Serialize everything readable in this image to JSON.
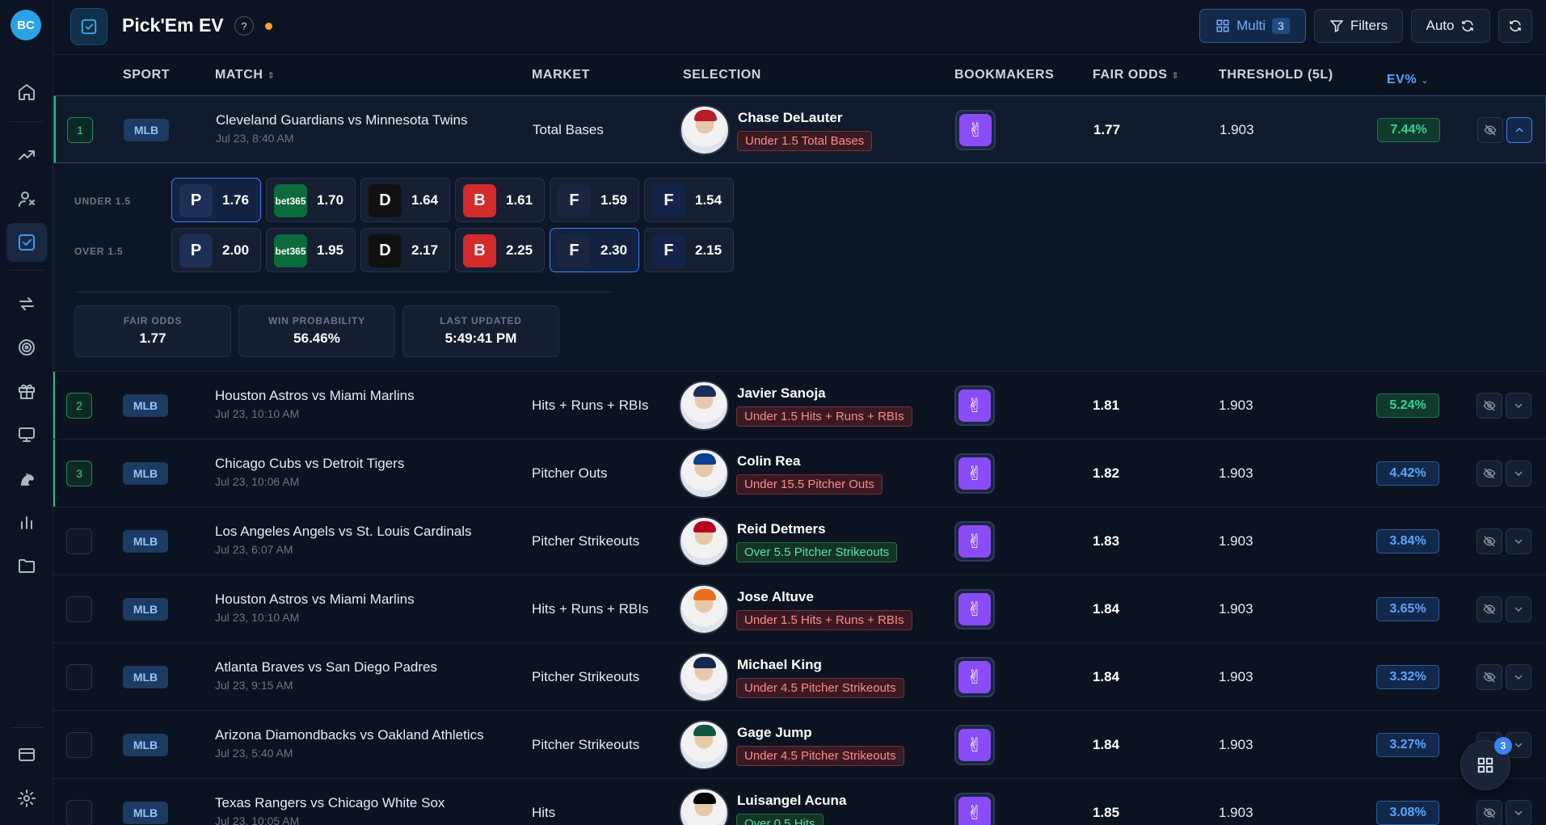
{
  "app": {
    "logo_text": "BC"
  },
  "sidebar": {
    "items": [
      {
        "icon": "home-icon"
      },
      {
        "icon": "trending-icon"
      },
      {
        "icon": "user-icon"
      },
      {
        "icon": "pickem-icon",
        "active": true
      },
      {
        "icon": "arbitrage-icon"
      },
      {
        "icon": "target-icon"
      },
      {
        "icon": "gift-icon"
      },
      {
        "icon": "monitor-icon"
      },
      {
        "icon": "horse-icon"
      },
      {
        "icon": "bar-chart-icon"
      },
      {
        "icon": "folder-icon"
      },
      {
        "icon": "card-icon"
      },
      {
        "icon": "settings-icon"
      }
    ]
  },
  "header": {
    "title": "Pick'Em EV",
    "help": "?",
    "multi_label": "Multi",
    "multi_count": "3",
    "filters_label": "Filters",
    "auto_label": "Auto"
  },
  "columns": {
    "sport": "SPORT",
    "match": "MATCH",
    "market": "MARKET",
    "selection": "SELECTION",
    "bookmakers": "BOOKMAKERS",
    "fair_odds": "FAIR ODDS",
    "threshold": "THRESHOLD (5L)",
    "ev": "EV%"
  },
  "rows": [
    {
      "rank": "1",
      "sport": "MLB",
      "match": "Cleveland Guardians vs Minnesota Twins",
      "time": "Jul 23, 8:40 AM",
      "market": "Total Bases",
      "player": "Chase DeLauter",
      "pick": "Under 1.5 Total Bases",
      "side": "under",
      "fair": "1.77",
      "threshold": "1.903",
      "ev": "7.44%",
      "ev_color": "green"
    },
    {
      "rank": "2",
      "sport": "MLB",
      "match": "Houston Astros vs Miami Marlins",
      "time": "Jul 23, 10:10 AM",
      "market": "Hits + Runs + RBIs",
      "player": "Javier Sanoja",
      "pick": "Under 1.5 Hits + Runs + RBIs",
      "side": "under",
      "fair": "1.81",
      "threshold": "1.903",
      "ev": "5.24%",
      "ev_color": "green"
    },
    {
      "rank": "3",
      "sport": "MLB",
      "match": "Chicago Cubs vs Detroit Tigers",
      "time": "Jul 23, 10:06 AM",
      "market": "Pitcher Outs",
      "player": "Colin Rea",
      "pick": "Under 15.5 Pitcher Outs",
      "side": "under",
      "fair": "1.82",
      "threshold": "1.903",
      "ev": "4.42%",
      "ev_color": "blue"
    },
    {
      "rank": "",
      "sport": "MLB",
      "match": "Los Angeles Angels vs St. Louis Cardinals",
      "time": "Jul 23, 6:07 AM",
      "market": "Pitcher Strikeouts",
      "player": "Reid Detmers",
      "pick": "Over 5.5 Pitcher Strikeouts",
      "side": "over",
      "fair": "1.83",
      "threshold": "1.903",
      "ev": "3.84%",
      "ev_color": "blue"
    },
    {
      "rank": "",
      "sport": "MLB",
      "match": "Houston Astros vs Miami Marlins",
      "time": "Jul 23, 10:10 AM",
      "market": "Hits + Runs + RBIs",
      "player": "Jose Altuve",
      "pick": "Under 1.5 Hits + Runs + RBIs",
      "side": "under",
      "fair": "1.84",
      "threshold": "1.903",
      "ev": "3.65%",
      "ev_color": "blue"
    },
    {
      "rank": "",
      "sport": "MLB",
      "match": "Atlanta Braves vs San Diego Padres",
      "time": "Jul 23, 9:15 AM",
      "market": "Pitcher Strikeouts",
      "player": "Michael King",
      "pick": "Under 4.5 Pitcher Strikeouts",
      "side": "under",
      "fair": "1.84",
      "threshold": "1.903",
      "ev": "3.32%",
      "ev_color": "blue"
    },
    {
      "rank": "",
      "sport": "MLB",
      "match": "Arizona Diamondbacks vs Oakland Athletics",
      "time": "Jul 23, 5:40 AM",
      "market": "Pitcher Strikeouts",
      "player": "Gage Jump",
      "pick": "Under 4.5 Pitcher Strikeouts",
      "side": "under",
      "fair": "1.84",
      "threshold": "1.903",
      "ev": "3.27%",
      "ev_color": "blue"
    },
    {
      "rank": "",
      "sport": "MLB",
      "match": "Texas Rangers vs Chicago White Sox",
      "time": "Jul 23, 10:05 AM",
      "market": "Hits",
      "player": "Luisangel Acuna",
      "pick": "Over 0.5 Hits",
      "side": "over",
      "fair": "1.85",
      "threshold": "1.903",
      "ev": "3.08%",
      "ev_color": "blue"
    }
  ],
  "expanded": {
    "under_label": "UNDER 1.5",
    "over_label": "OVER 1.5",
    "books": [
      {
        "name": "PrizePicks",
        "mark": "P",
        "color": "#1d2f55",
        "under": "1.76",
        "over": "2.00"
      },
      {
        "name": "bet365",
        "mark": "bet365",
        "color": "#0b6b3a",
        "under": "1.70",
        "over": "1.95"
      },
      {
        "name": "DraftKings",
        "mark": "D",
        "color": "#111111",
        "under": "1.64",
        "over": "2.17"
      },
      {
        "name": "Betr",
        "mark": "B",
        "color": "#d42a2a",
        "under": "1.61",
        "over": "2.25"
      },
      {
        "name": "Fanatics",
        "mark": "F",
        "color": "#1a2540",
        "under": "1.59",
        "over": "2.30"
      },
      {
        "name": "FanDuel",
        "mark": "F",
        "color": "#14234a",
        "under": "1.54",
        "over": "2.15"
      }
    ],
    "best_under": 0,
    "best_over": 4,
    "stats": [
      {
        "label": "FAIR ODDS",
        "value": "1.77"
      },
      {
        "label": "WIN PROBABILITY",
        "value": "56.46%"
      },
      {
        "label": "LAST UPDATED",
        "value": "5:49:41 PM"
      }
    ]
  },
  "fab": {
    "badge": "3"
  }
}
